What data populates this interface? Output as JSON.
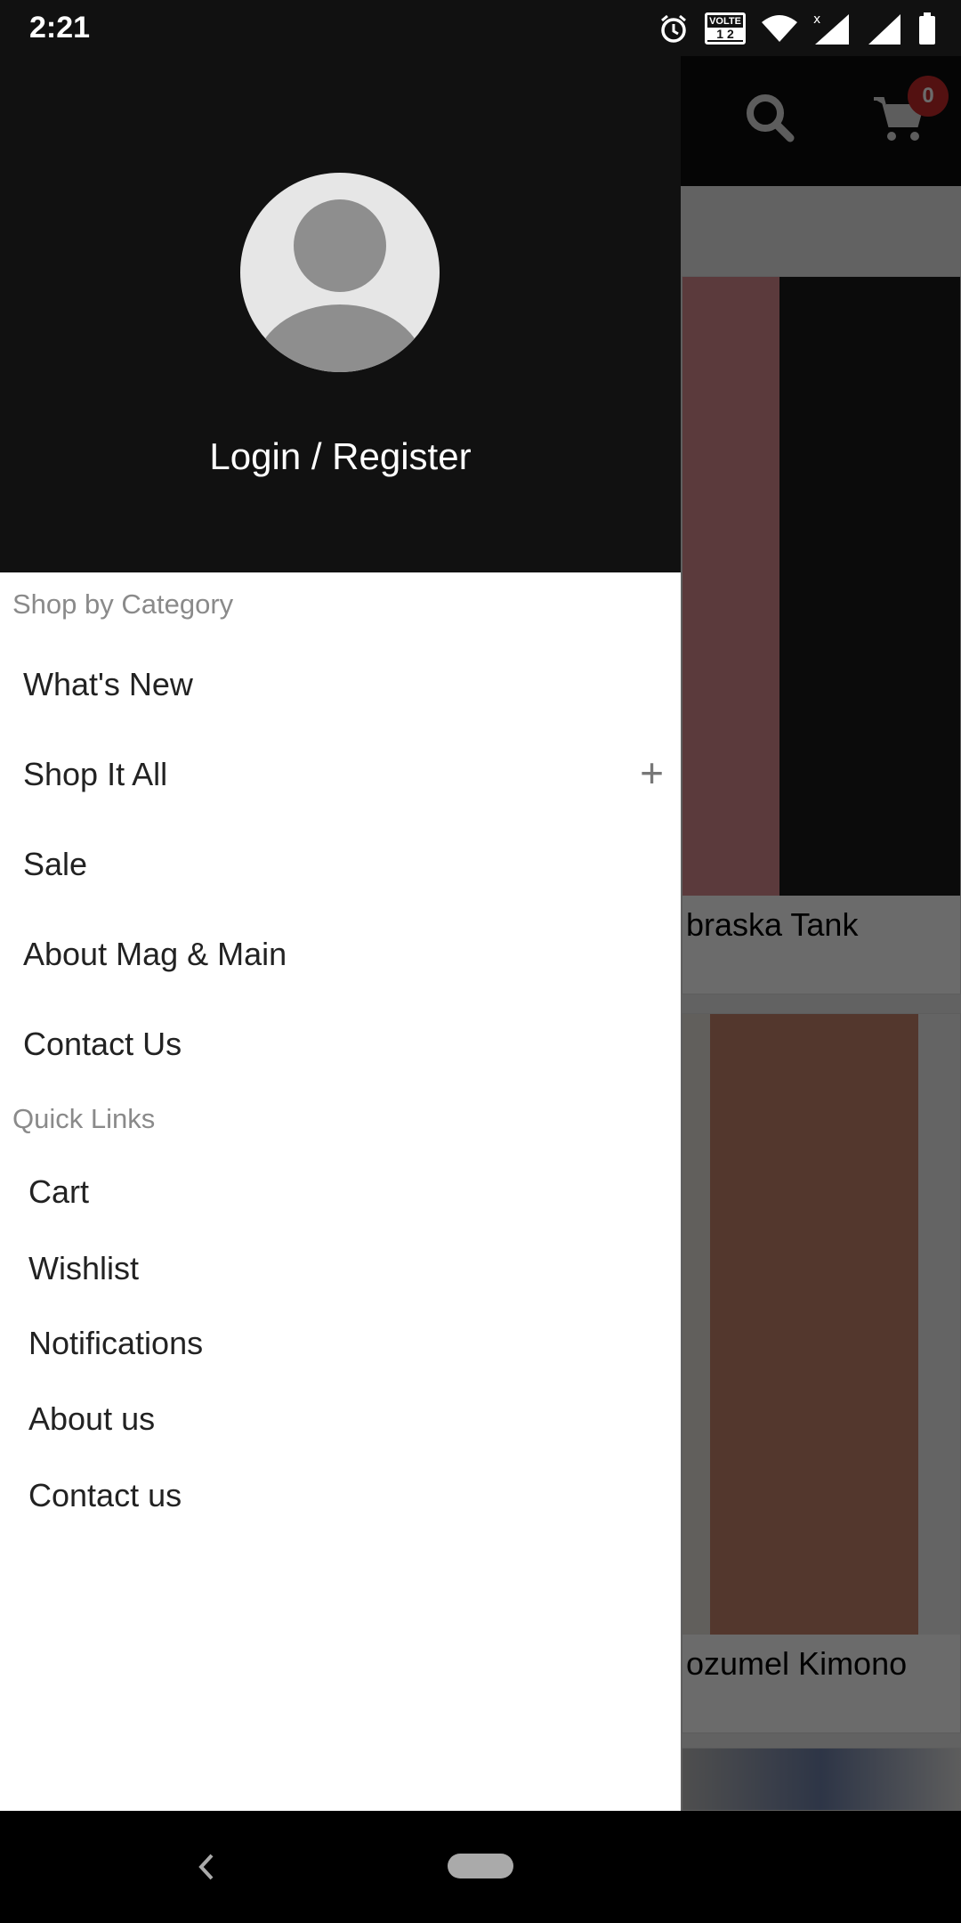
{
  "status_bar": {
    "time": "2:21",
    "icons": [
      "alarm-icon",
      "volte-icon",
      "wifi-icon",
      "signal-icon",
      "signal-icon",
      "battery-icon"
    ],
    "volte_label": "VOLTE",
    "sim_label": "1 2"
  },
  "app_header": {
    "cart_count": "0",
    "badge_color": "#c62828"
  },
  "products": [
    {
      "title": "Nebraska Tank",
      "visible_title": "braska Tank"
    },
    {
      "title": "Cozumel Kimono",
      "visible_title": "ozumel Kimono"
    }
  ],
  "drawer": {
    "login_label": "Login / Register",
    "category_header": "Shop by Category",
    "categories": [
      {
        "label": "What's New"
      },
      {
        "label": "Shop It All",
        "expand": "+"
      },
      {
        "label": "Sale"
      },
      {
        "label": "About Mag & Main"
      },
      {
        "label": "Contact Us"
      }
    ],
    "quick_header": "Quick Links",
    "quick_links": [
      {
        "label": "Cart"
      },
      {
        "label": "Wishlist"
      },
      {
        "label": "Notifications"
      },
      {
        "label": "About us"
      },
      {
        "label": "Contact us"
      }
    ]
  }
}
